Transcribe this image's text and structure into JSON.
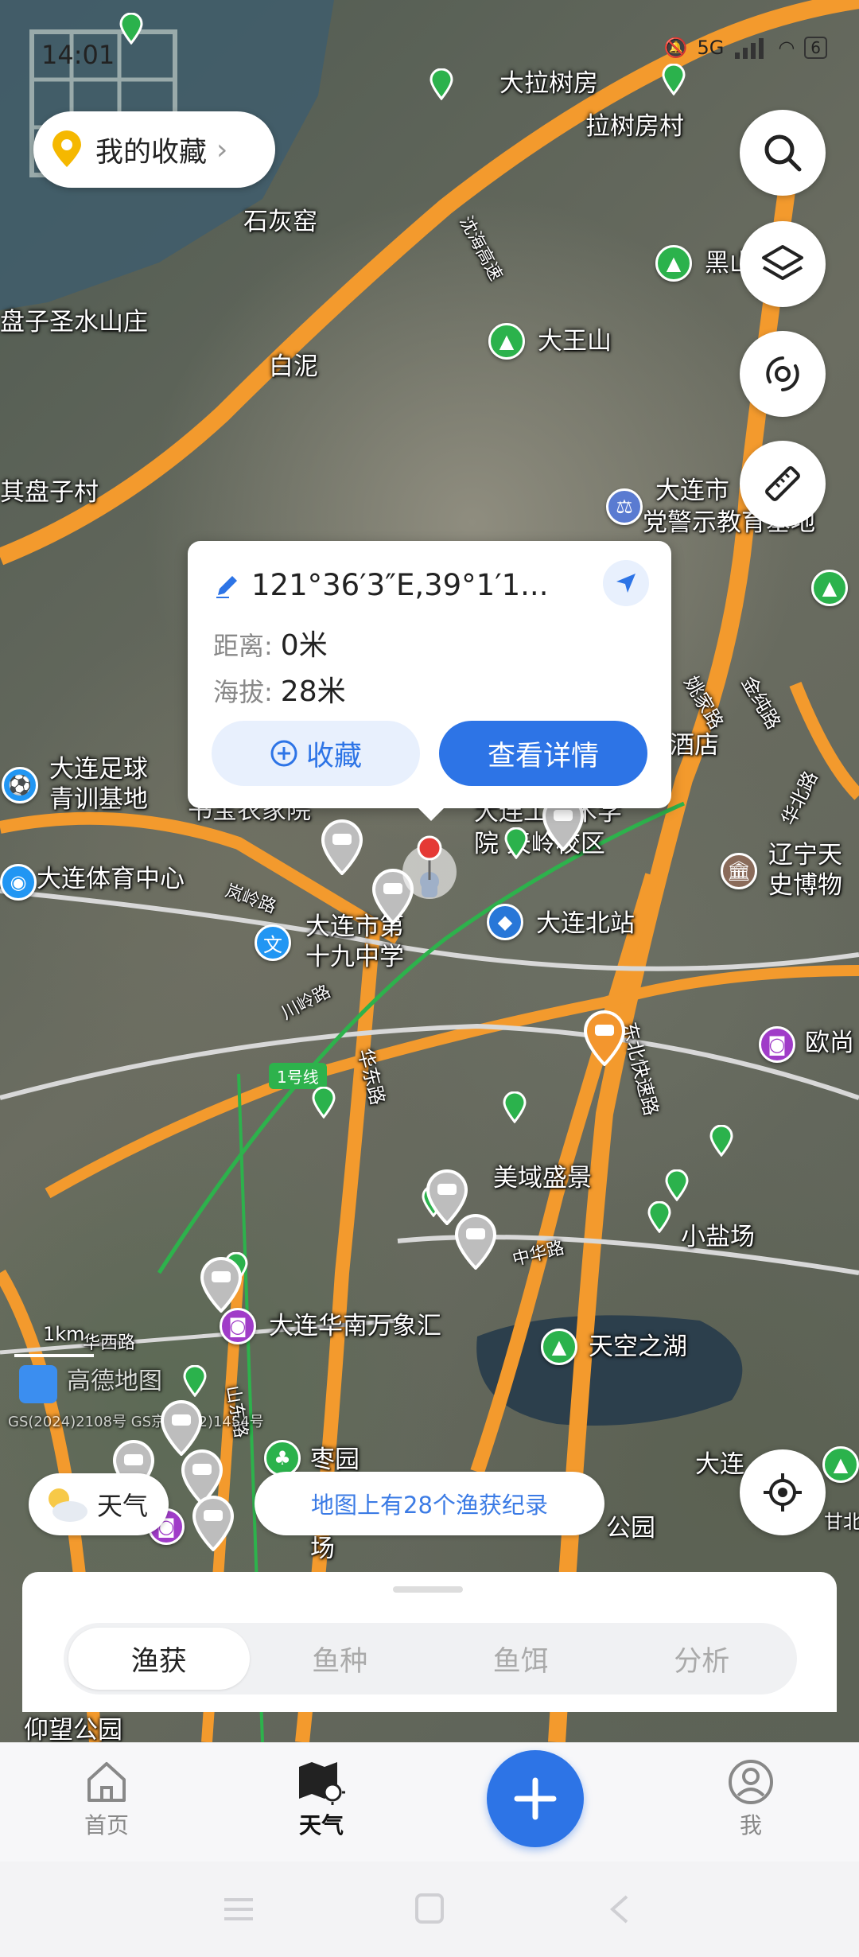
{
  "status": {
    "time": "14:01",
    "network": "5G",
    "battery": "6"
  },
  "favorites": {
    "label": "我的收藏"
  },
  "tools": {
    "search": "search-icon",
    "layers": "layers-icon",
    "typhoon": "typhoon-icon",
    "ruler": "ruler-icon"
  },
  "map_labels": {
    "l1": "大拉树房",
    "l2": "拉树房村",
    "l3": "石灰窑",
    "l4": "黑山",
    "l5": "盘子圣水山庄",
    "l6": "大王山",
    "l7": "白泥",
    "l8": "其盘子村",
    "l9a": "大连市",
    "l9b": "党警示教育基地",
    "l10a": "大连足球",
    "l10b": "青训基地",
    "l11": "大连体育中心",
    "l12a": "大连市第",
    "l12b": "十九中学",
    "l13": "大连北站",
    "l14a": "辽宁天",
    "l14b": "史博物",
    "l15": "欧尚",
    "l16": "美域盛景",
    "l17": "小盐场",
    "l18": "大连华南万象汇",
    "l19": "天空之湖",
    "l20": "枣园",
    "l21": "大连",
    "l22": "仰望公园",
    "l23": "酒店",
    "l24a": "大连工技术学",
    "l24b": "院 天岭校区",
    "l25": "书宝农家院",
    "road1": "沈海高速",
    "road2": "岚岭路",
    "road3": "川岭路",
    "road4": "东北快速路",
    "road5": "华东路",
    "road6": "中华路",
    "road7": "华北路",
    "road8": "山东路",
    "road9": "华西路",
    "road10": "姚家路",
    "road11": "金纯路",
    "metro": "1号线",
    "scale": "1km",
    "brand": "高德地图",
    "copyright": "GS(2024)2108号 GS京(2022)1454号",
    "l26": "公园",
    "l27": "场",
    "l28": "甘北"
  },
  "popup": {
    "coords": "121°36′3″E,39°1′1...",
    "distance_label": "距离:",
    "distance_value": "0米",
    "altitude_label": "海拔:",
    "altitude_value": "28米",
    "fav_button": "收藏",
    "detail_button": "查看详情"
  },
  "weather": {
    "label": "天气"
  },
  "record_tip": "地图上有28个渔获纪录",
  "segments": [
    "渔获",
    "鱼种",
    "鱼饵",
    "分析"
  ],
  "tabs": {
    "home": "首页",
    "weather": "天气",
    "me": "我"
  },
  "colors": {
    "accent": "#2d74e6",
    "road": "#f39a2d",
    "poi_green": "#2bb24c"
  }
}
